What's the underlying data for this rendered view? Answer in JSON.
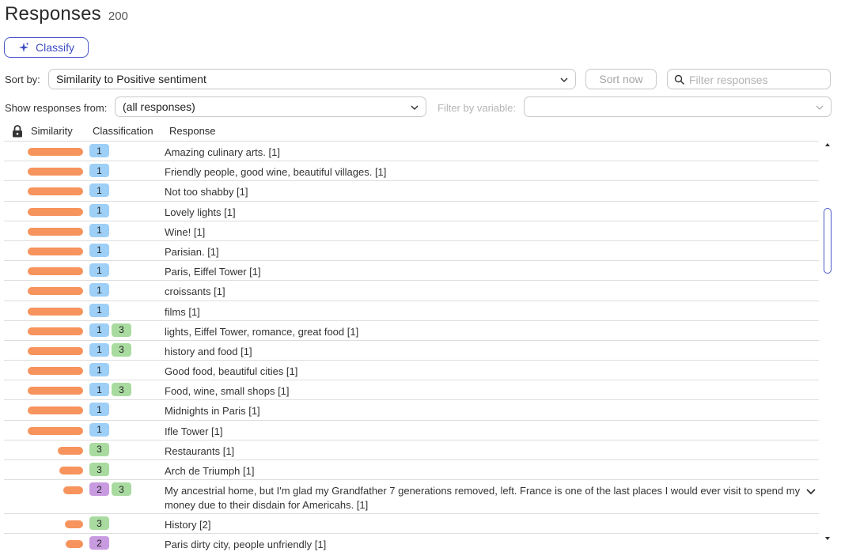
{
  "header": {
    "title": "Responses",
    "count": "200"
  },
  "classify_label": "Classify",
  "sort": {
    "label": "Sort by:",
    "value": "Similarity to Positive sentiment",
    "sort_now": "Sort now"
  },
  "filter": {
    "placeholder": "Filter responses"
  },
  "show_from": {
    "label": "Show responses from:",
    "value": "(all responses)"
  },
  "filter_var": {
    "label": "Filter by variable:",
    "value": ""
  },
  "columns": {
    "similarity": "Similarity",
    "classification": "Classification",
    "response": "Response"
  },
  "colors": {
    "accent": "#3d4ac4",
    "bar": "#f7935c",
    "class_1": "#9ecff6",
    "class_2": "#c89ae0",
    "class_3": "#a9dba0"
  },
  "rows": [
    {
      "similarity": 1.0,
      "classes": [
        "1"
      ],
      "text": "Amazing culinary arts. [1]"
    },
    {
      "similarity": 1.0,
      "classes": [
        "1"
      ],
      "text": "Friendly people, good wine, beautiful villages. [1]"
    },
    {
      "similarity": 1.0,
      "classes": [
        "1"
      ],
      "text": "Not too shabby [1]"
    },
    {
      "similarity": 1.0,
      "classes": [
        "1"
      ],
      "text": "Lovely lights [1]"
    },
    {
      "similarity": 1.0,
      "classes": [
        "1"
      ],
      "text": "Wine! [1]"
    },
    {
      "similarity": 1.0,
      "classes": [
        "1"
      ],
      "text": "Parisian. [1]"
    },
    {
      "similarity": 1.0,
      "classes": [
        "1"
      ],
      "text": "Paris, Eiffel Tower [1]"
    },
    {
      "similarity": 1.0,
      "classes": [
        "1"
      ],
      "text": "croissants [1]"
    },
    {
      "similarity": 1.0,
      "classes": [
        "1"
      ],
      "text": "films [1]"
    },
    {
      "similarity": 1.0,
      "classes": [
        "1",
        "3"
      ],
      "text": "lights, Eiffel Tower, romance, great food [1]"
    },
    {
      "similarity": 1.0,
      "classes": [
        "1",
        "3"
      ],
      "text": "history and food [1]"
    },
    {
      "similarity": 1.0,
      "classes": [
        "1"
      ],
      "text": "Good food, beautiful cities [1]"
    },
    {
      "similarity": 1.0,
      "classes": [
        "1",
        "3"
      ],
      "text": "Food, wine, small shops [1]"
    },
    {
      "similarity": 1.0,
      "classes": [
        "1"
      ],
      "text": "Midnights in Paris [1]"
    },
    {
      "similarity": 1.0,
      "classes": [
        "1"
      ],
      "text": "Ifle Tower [1]"
    },
    {
      "similarity": 0.45,
      "classes": [
        "3"
      ],
      "text": "Restaurants [1]"
    },
    {
      "similarity": 0.43,
      "classes": [
        "3"
      ],
      "text": "Arch de Triumph [1]"
    },
    {
      "similarity": 0.36,
      "classes": [
        "2",
        "3"
      ],
      "text": "My ancestrial home, but I'm glad my Grandfather 7 generations removed, left. France is one of the last places I would ever visit to spend my money due to their disdain for Americahs. [1]",
      "tall": true
    },
    {
      "similarity": 0.33,
      "classes": [
        "3"
      ],
      "text": "History [2]"
    },
    {
      "similarity": 0.31,
      "classes": [
        "2"
      ],
      "text": "Paris dirty city, people unfriendly [1]"
    }
  ]
}
